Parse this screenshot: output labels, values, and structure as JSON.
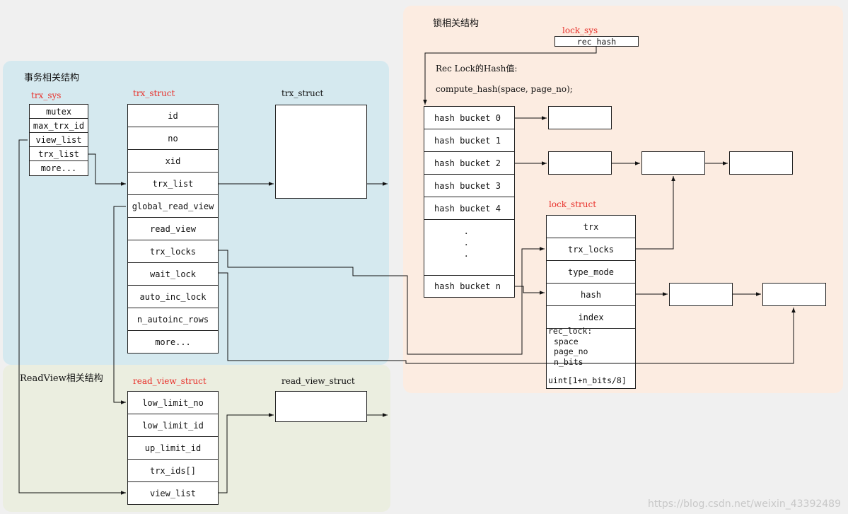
{
  "sections": {
    "transaction": "事务相关结构",
    "readview": "ReadView相关结构",
    "lock": "锁相关结构"
  },
  "trx_sys": {
    "title": "trx_sys",
    "fields": [
      "mutex",
      "max_trx_id",
      "view_list",
      "trx_list",
      "more..."
    ]
  },
  "trx_struct": {
    "title": "trx_struct",
    "fields": [
      "id",
      "no",
      "xid",
      "trx_list",
      "global_read_view",
      "read_view",
      "trx_locks",
      "wait_lock",
      "auto_inc_lock",
      "n_autoinc_rows",
      "more..."
    ]
  },
  "trx_struct_next": {
    "title": "trx_struct"
  },
  "read_view_struct": {
    "title": "read_view_struct",
    "fields": [
      "low_limit_no",
      "low_limit_id",
      "up_limit_id",
      "trx_ids[]",
      "view_list"
    ]
  },
  "read_view_struct_next": {
    "title": "read_view_struct"
  },
  "lock_sys": {
    "title": "lock_sys",
    "field": "rec_hash"
  },
  "hash_note": {
    "line1": "Rec Lock的Hash值:",
    "line2": "compute_hash(space, page_no);"
  },
  "hash_table": {
    "buckets": [
      "hash bucket 0",
      "hash bucket 1",
      "hash bucket 2",
      "hash bucket 3",
      "hash bucket 4",
      "hash bucket n"
    ],
    "ellipsis": [
      "·",
      "·",
      "·"
    ]
  },
  "lock_struct": {
    "title": "lock_struct",
    "fields": [
      "trx",
      "trx_locks",
      "type_mode",
      "hash",
      "index"
    ],
    "rec_lock": {
      "header": "rec_lock:",
      "items": [
        "space",
        "page_no",
        "n_bits"
      ],
      "footer": "uint[1+n_bits/8]"
    }
  },
  "watermark": "https://blog.csdn.net/weixin_43392489",
  "colors": {
    "transaction_bg": "#d5e9ef",
    "readview_bg": "#ebeee0",
    "lock_bg": "#fcece1",
    "struct_title": "#e8302a"
  }
}
